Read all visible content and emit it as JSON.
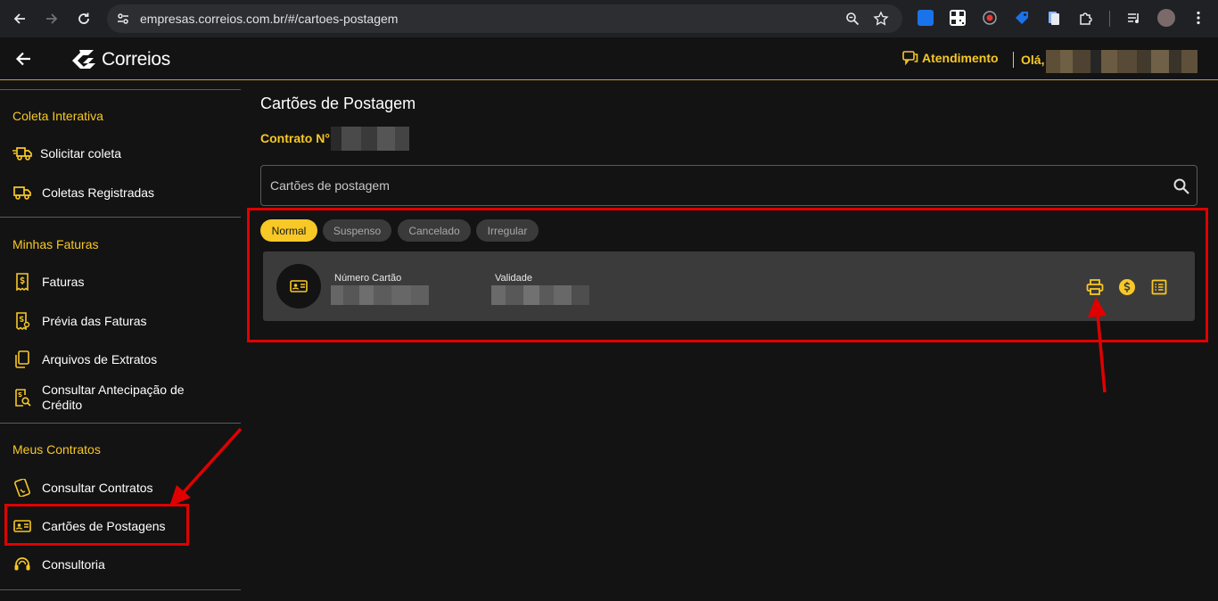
{
  "browser": {
    "url": "empresas.correios.com.br/#/cartoes-postagem",
    "extensions": [
      "id-card-extension-icon",
      "qr-code-extension-icon",
      "record-extension-icon",
      "tag-extension-icon",
      "document-extension-icon",
      "puzzle-extensions-icon",
      "media-control-icon",
      "profile-avatar-icon",
      "menu-kebab-icon"
    ]
  },
  "header": {
    "logo_text": "Correios",
    "atendimento_label": "Atendimento",
    "greeting": "Olá,"
  },
  "sidebar": {
    "sections": [
      {
        "title": "Coleta Interativa"
      },
      {
        "title": "Minhas Faturas"
      },
      {
        "title": "Meus Contratos"
      }
    ],
    "items": [
      {
        "label": "Solicitar coleta",
        "icon": "truck-fast-icon"
      },
      {
        "label": "Coletas Registradas",
        "icon": "truck-icon"
      },
      {
        "label": "Faturas",
        "icon": "invoice-dollar-icon"
      },
      {
        "label": "Prévia das Faturas",
        "icon": "invoice-preview-icon"
      },
      {
        "label": "Arquivos de Extratos",
        "icon": "files-icon"
      },
      {
        "label": "Consultar Antecipação de Crédito",
        "icon": "credit-search-icon"
      },
      {
        "label": "Consultar Contratos",
        "icon": "contract-icon"
      },
      {
        "label": "Cartões de Postagens",
        "icon": "id-card-icon"
      },
      {
        "label": "Consultoria",
        "icon": "headset-icon"
      }
    ]
  },
  "main": {
    "title": "Cartões de Postagem",
    "contract_label": "Contrato N°:",
    "search_placeholder": "Cartões de postagem",
    "filters": [
      "Normal",
      "Suspenso",
      "Cancelado",
      "Irregular"
    ],
    "active_filter": "Normal",
    "card": {
      "number_label": "Número Cartão",
      "validity_label": "Validade",
      "actions": [
        "print-icon",
        "dollar-circle-icon",
        "list-icon"
      ]
    }
  },
  "colors": {
    "accent": "#f7c826",
    "background": "#131313",
    "card_background": "#3b3b3b",
    "annotation": "#e00000"
  }
}
